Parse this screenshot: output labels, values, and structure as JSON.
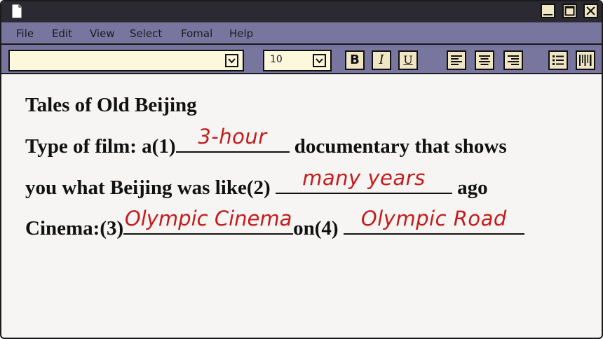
{
  "titlebar": {
    "icon": "document-icon",
    "buttons": [
      "minimize-icon",
      "maximize-icon",
      "close-icon"
    ]
  },
  "menu": {
    "items": [
      "File",
      "Edit",
      "View",
      "Select",
      "Fomal",
      "Help"
    ]
  },
  "toolbar": {
    "font_name_value": "",
    "font_size_value": "10",
    "format_buttons": [
      "bold-icon",
      "italic-icon",
      "underline-icon"
    ],
    "format_glyphs": [
      "B",
      "I",
      "U"
    ],
    "align_buttons": [
      "align-left-icon",
      "align-center-icon",
      "align-right-icon"
    ],
    "list_buttons": [
      "list-icon",
      "barcode-icon"
    ]
  },
  "document": {
    "title": "Tales of Old Beijing",
    "line1_a": "Type of film: a(1)",
    "line1_b": "documentary that shows",
    "line2_a": "you what Beijing was like(2)",
    "line2_b": "ago",
    "line3_a": "Cinema:(3)",
    "line3_b": "on(4)",
    "answers": {
      "a1": "3-hour",
      "a2": "many years",
      "a3": "Olympic Cinema",
      "a4": "Olympic Road"
    },
    "answer_color": "#c41c1c"
  }
}
